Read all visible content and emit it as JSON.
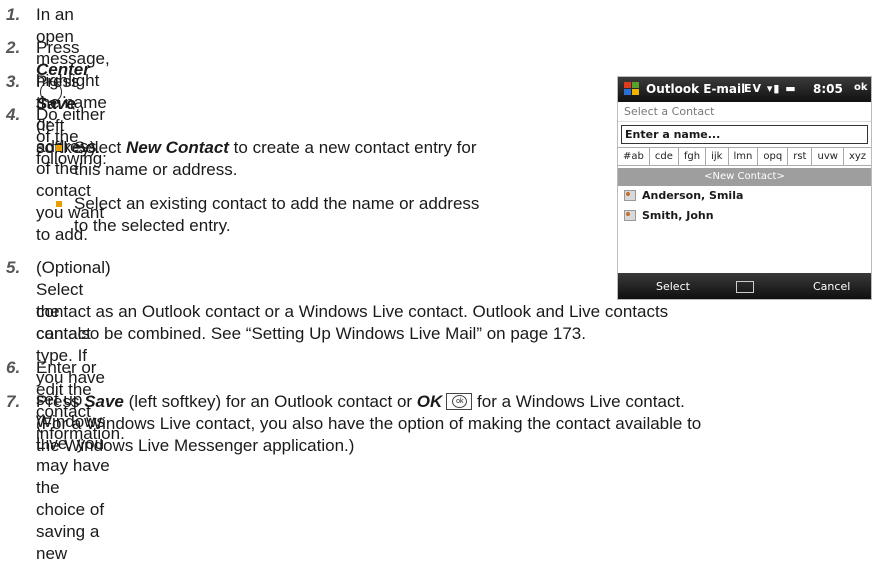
{
  "steps": [
    {
      "num": "1.",
      "text": "In an open message, highlight the name or address of the contact you want to add."
    },
    {
      "num": "2.",
      "pre": "Press ",
      "bold": "Center",
      "post": ""
    },
    {
      "num": "3.",
      "pre": "Press ",
      "bold": "Save",
      "post": " (left softkey)."
    },
    {
      "num": "4.",
      "text": "Do either of the following:"
    },
    {
      "num": "5.",
      "line1": "(Optional) Select the contact type. If you have set up",
      "line2": "Windows Live, you may have the choice of saving a new",
      "line3": "contact as an Outlook contact or a Windows Live contact. Outlook and Live contacts",
      "line4": "can also be combined. See “Setting Up Windows Live Mail” on page 173."
    },
    {
      "num": "6.",
      "text": "Enter or edit the contact information."
    },
    {
      "num": "7.",
      "pre": "Press ",
      "bold": "Save",
      "mid": " (left softkey) for an Outlook contact or ",
      "bold2": "OK",
      "post": " for a Windows Live contact.",
      "line2": "(For a Windows Live contact, you also have the option of making the contact available to",
      "line3": "the Windows Live Messenger application.)"
    }
  ],
  "bullets": [
    {
      "pre": "Select ",
      "bold": "New Contact",
      "post": " to create a new contact entry for",
      "line2": "this name or address."
    },
    {
      "text": "Select an existing contact to add the name or address",
      "line2": "to the selected entry."
    }
  ],
  "phone": {
    "title": "Outlook E-mail",
    "status_icons": "EV ▾▮ ▬",
    "time": "8:05",
    "ok": "ok",
    "subtitle": "Select a Contact",
    "input_value": "Enter a name...",
    "tabs": [
      "#ab",
      "cde",
      "fgh",
      "ijk",
      "lmn",
      "opq",
      "rst",
      "uvw",
      "xyz"
    ],
    "new_contact": "<New Contact>",
    "contacts": [
      "Anderson, Smila",
      "Smith, John"
    ],
    "softkey_left": "Select",
    "softkey_right": "Cancel"
  },
  "colors": {
    "bullet": "#e5a100",
    "windows_red": "#e03a1e",
    "windows_green": "#5aa02c",
    "windows_blue": "#2a6fd1",
    "windows_yellow": "#f0b400"
  },
  "icons": [
    "center-circle-icon",
    "ok-key-icon",
    "windows-logo-icon",
    "keyboard-icon",
    "contact-card-icon"
  ]
}
